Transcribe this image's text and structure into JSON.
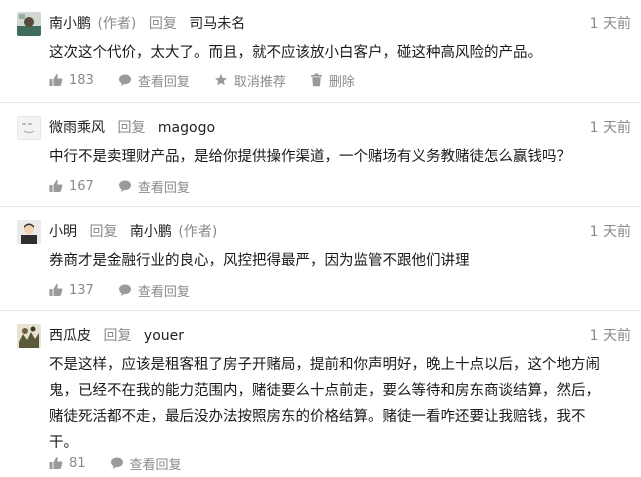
{
  "comments": [
    {
      "author": "南小鹏",
      "author_tag": "(作者)",
      "reply_word": "回复",
      "reply_to": "司马未名",
      "reply_to_tag": "",
      "time": "1 天前",
      "text": "这次这个代价，太大了。而且，就不应该放小白客户，碰这种高风险的产品。",
      "likes": "183",
      "view_replies": "查看回复",
      "unrecommend": "取消推荐",
      "delete": "删除"
    },
    {
      "author": "微雨乘风",
      "author_tag": "",
      "reply_word": "回复",
      "reply_to": "magogo",
      "reply_to_tag": "",
      "time": "1 天前",
      "text": "中行不是卖理财产品，是给你提供操作渠道，一个赌场有义务教赌徒怎么赢钱吗？",
      "likes": "167",
      "view_replies": "查看回复"
    },
    {
      "author": "小明",
      "author_tag": "",
      "reply_word": "回复",
      "reply_to": "南小鹏",
      "reply_to_tag": "(作者)",
      "time": "1 天前",
      "text": "券商才是金融行业的良心，风控把得最严，因为监管不跟他们讲理",
      "likes": "137",
      "view_replies": "查看回复"
    },
    {
      "author": "西瓜皮",
      "author_tag": "",
      "reply_word": "回复",
      "reply_to": "youer",
      "reply_to_tag": "",
      "time": "1 天前",
      "text": "不是这样，应该是租客租了房子开赌局，提前和你声明好，晚上十点以后，这个地方闹鬼，已经不在我的能力范围内，赌徒要么十点前走，要么等待和房东商谈结算，然后，赌徒死活都不走，最后没办法按照房东的价格结算。赌徒一看咋还要让我赔钱，我不干。",
      "likes": "81",
      "view_replies": "查看回复"
    }
  ],
  "icons": {
    "like": "thumbs-up-icon",
    "replies": "speech-bubble-icon",
    "unrecommend": "star-icon",
    "delete": "trash-icon"
  },
  "colors": {
    "muted": "#8a8a8a",
    "text": "#1a1a1a",
    "divider": "#e6e6e6"
  }
}
